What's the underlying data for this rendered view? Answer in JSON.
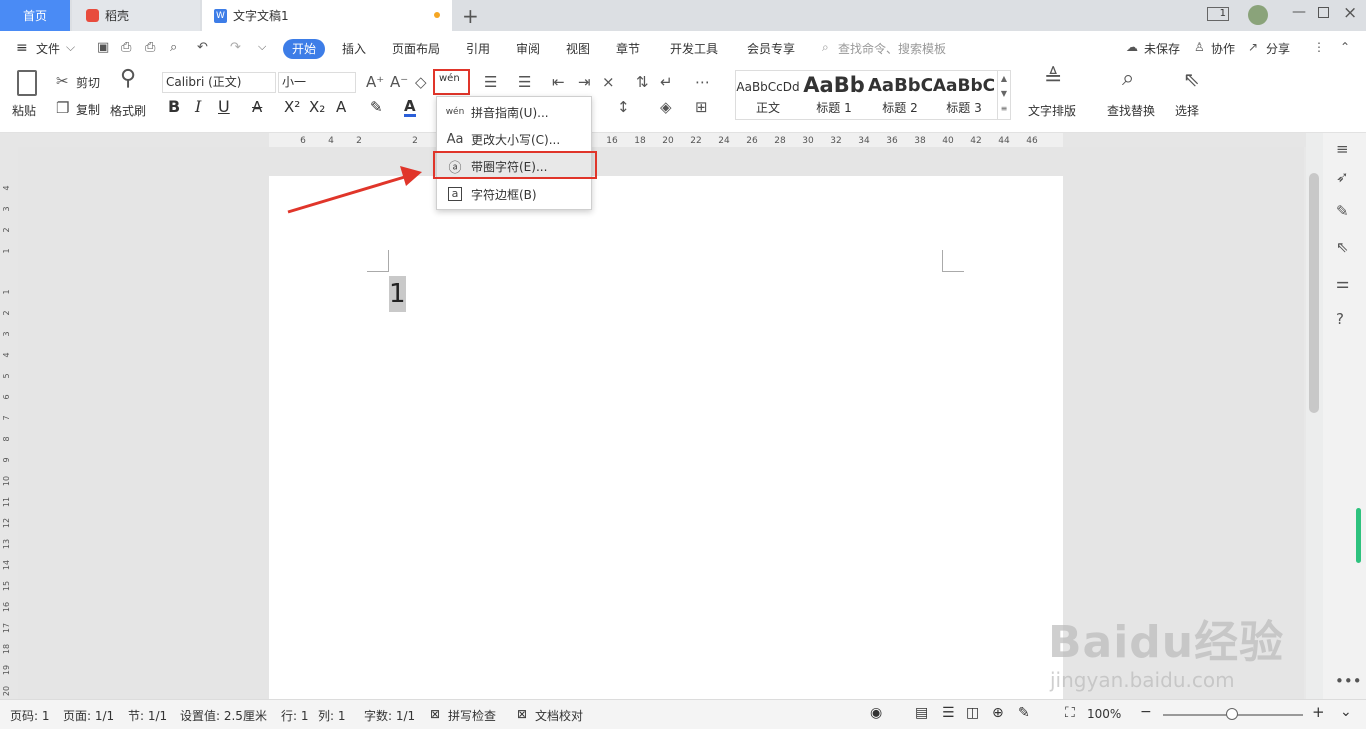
{
  "tabs": {
    "home": "首页",
    "daoke": "稻壳",
    "doc": "文字文稿1"
  },
  "titlebar": {
    "page_indicator": "1"
  },
  "menu": {
    "file": "文件",
    "start": "开始",
    "insert": "插入",
    "layout": "页面布局",
    "reference": "引用",
    "review": "审阅",
    "view": "视图",
    "section": "章节",
    "devtools": "开发工具",
    "vip": "会员专享",
    "search_placeholder": "查找命令、搜索模板",
    "unsaved": "未保存",
    "collab": "协作",
    "share": "分享"
  },
  "ribbon": {
    "paste": "粘贴",
    "cut": "剪切",
    "copy": "复制",
    "format_painter": "格式刷",
    "font": "Calibri (正文)",
    "size": "小一",
    "bold": "B",
    "italic": "I",
    "underline": "U",
    "superscript": "X²",
    "subscript": "X₂",
    "font_color": "A",
    "phonetic": "wén",
    "text_layout": "文字排版",
    "find_replace": "查找替换",
    "select": "选择"
  },
  "styles": [
    {
      "sample": "AaBbCcDd",
      "name": "正文"
    },
    {
      "sample": "AaBb",
      "name": "标题 1"
    },
    {
      "sample": "AaBbC",
      "name": "标题 2"
    },
    {
      "sample": "AaBbC",
      "name": "标题 3"
    }
  ],
  "dropdown": [
    {
      "icon": "wén",
      "label": "拼音指南(U)..."
    },
    {
      "icon": "Aa",
      "label": "更改大小写(C)..."
    },
    {
      "icon": "ⓐ",
      "label": "带圈字符(E)..."
    },
    {
      "icon": "a",
      "label": "字符边框(B)"
    }
  ],
  "ruler": {
    "top_ticks": [
      "6",
      "4",
      "2",
      "2",
      "16",
      "18",
      "20",
      "22",
      "24",
      "26",
      "28",
      "30",
      "32",
      "34",
      "36",
      "38",
      "40",
      "42",
      "44",
      "46"
    ],
    "left_ticks": [
      "4",
      "3",
      "2",
      "1",
      "1",
      "2",
      "3",
      "4",
      "5",
      "6",
      "7",
      "8",
      "9",
      "10",
      "11",
      "12",
      "13",
      "14",
      "15",
      "16",
      "17",
      "18",
      "19",
      "20"
    ]
  },
  "document": {
    "text": "1"
  },
  "status": {
    "page_code": "页码: 1",
    "pages": "页面: 1/1",
    "section": "节: 1/1",
    "setting": "设置值: 2.5厘米",
    "row": "行: 1",
    "col": "列: 1",
    "words": "字数: 1/1",
    "spellcheck": "拼写检查",
    "proofread": "文档校对",
    "zoom": "100%"
  },
  "watermark": {
    "brand": "Baidu经验",
    "url": "jingyan.baidu.com"
  },
  "colors": {
    "accent": "#3d7de7",
    "highlight": "#e0352a",
    "tab_active": "#4a8bf5"
  }
}
